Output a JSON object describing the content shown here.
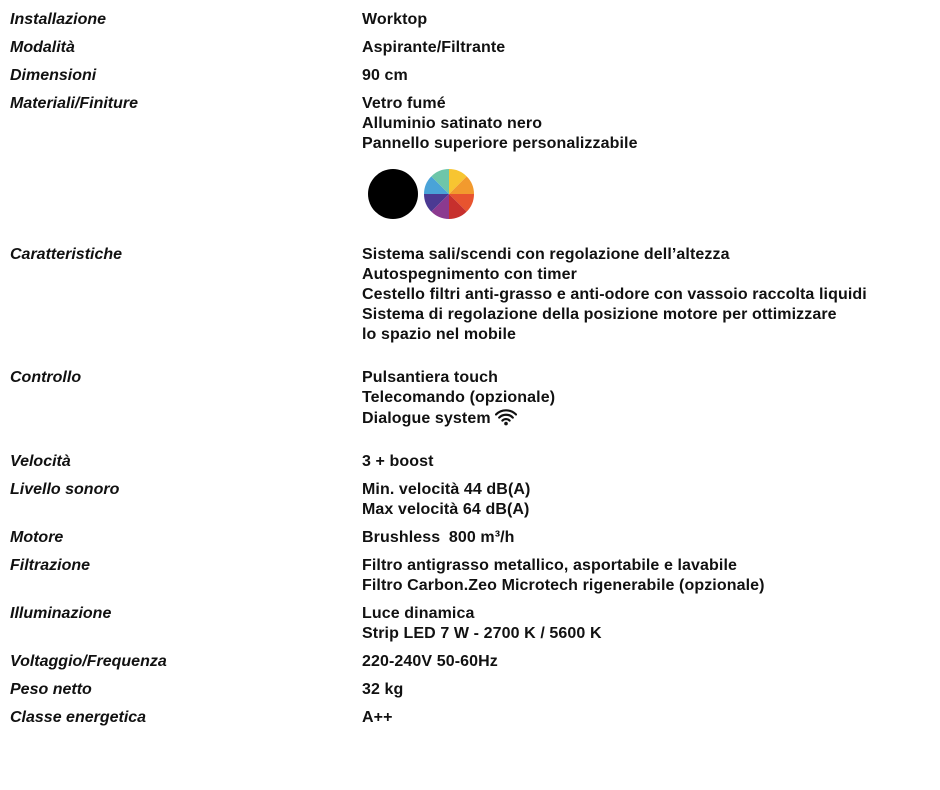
{
  "rows": [
    {
      "label": "Installazione",
      "lines": [
        "Worktop"
      ]
    },
    {
      "label": "Modalità",
      "lines": [
        "Aspirante/Filtrante"
      ]
    },
    {
      "label": "Dimensioni",
      "lines": [
        "90 cm"
      ]
    },
    {
      "label": "Materiali/Finiture",
      "lines": [
        "Vetro fumé",
        "Alluminio satinato nero",
        "Pannello superiore personalizzabile"
      ]
    },
    {
      "label": "Caratteristiche",
      "lines": [
        "Sistema sali/scendi con regolazione dell’altezza",
        "Autospegnimento con timer",
        "Cestello filtri anti-grasso e anti-odore con vassoio raccolta liquidi",
        "Sistema di regolazione della posizione motore per ottimizzare",
        "lo spazio nel mobile"
      ]
    },
    {
      "label": "Controllo",
      "lines": [
        "Pulsantiera touch",
        "Telecomando (opzionale)",
        "Dialogue system"
      ]
    },
    {
      "label": "Velocità",
      "lines": [
        "3 + boost"
      ]
    },
    {
      "label": "Livello sonoro",
      "lines": [
        "Min. velocità 44 dB(A)",
        "Max velocità 64 dB(A)"
      ]
    },
    {
      "label": "Motore",
      "lines": [
        "Brushless",
        "800 m³/h"
      ]
    },
    {
      "label": "Filtrazione",
      "lines": [
        "Filtro antigrasso metallico, asportabile e lavabile",
        "Filtro Carbon.Zeo Microtech rigenerabile (opzionale)"
      ]
    },
    {
      "label": "Illuminazione",
      "lines": [
        "Luce dinamica",
        "Strip LED 7 W - 2700 K / 5600 K"
      ]
    },
    {
      "label": "Voltaggio/Frequenza",
      "lines": [
        "220-240V 50-60Hz"
      ]
    },
    {
      "label": "Peso netto",
      "lines": [
        "32 kg"
      ]
    },
    {
      "label": "Classe energetica",
      "lines": [
        "A++"
      ]
    }
  ],
  "swatches": [
    {
      "name": "black",
      "color": "#000000"
    },
    {
      "name": "multicolor",
      "colors": [
        "#f7c531",
        "#f29a2e",
        "#e8542f",
        "#c7302d",
        "#8b3a8f",
        "#4b3a93",
        "#4aa3d8",
        "#6ec6a9"
      ]
    }
  ],
  "icons": {
    "controllo_dialogue": "wifi-icon"
  }
}
